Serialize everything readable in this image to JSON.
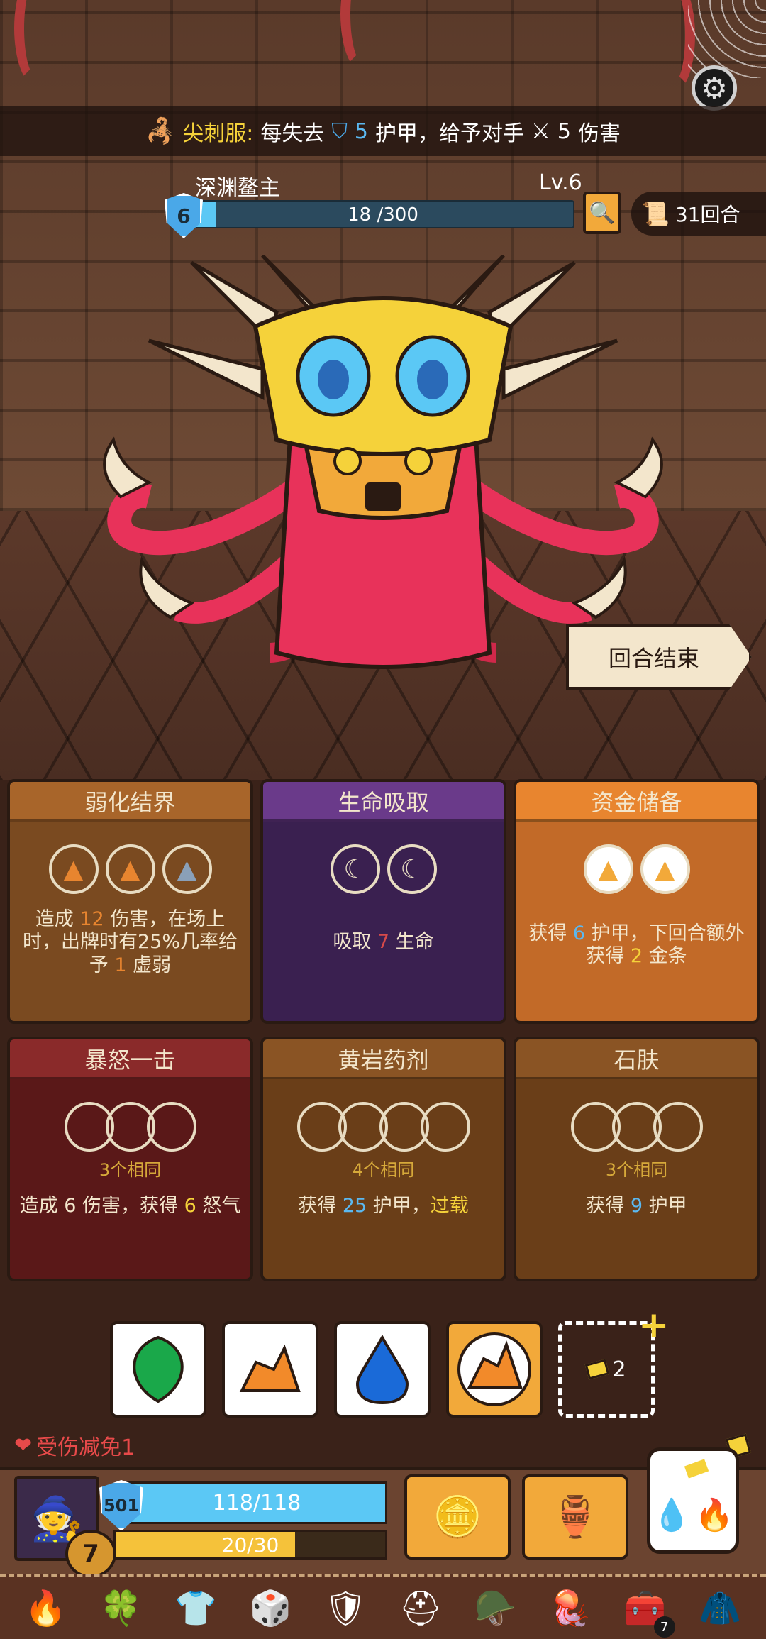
{
  "boss_trait": {
    "name": "尖刺服:",
    "text_before": "每失去",
    "armor_amount": "5",
    "text_middle": "护甲，给予对手",
    "damage_amount": "5",
    "text_after": "伤害"
  },
  "enemy": {
    "name": "深渊鳌主",
    "level": "Lv.6",
    "shield": "6",
    "hp_text": "18 /300",
    "hp_fraction": 0.06
  },
  "turns": "31回合",
  "end_turn_label": "回合结束",
  "cards": [
    {
      "title": "弱化结界",
      "desc_parts": [
        "造成 ",
        "12",
        " 伤害，在场上时，出牌时有25%几率给予 ",
        "1",
        " 虚弱"
      ]
    },
    {
      "title": "生命吸取",
      "desc_parts": [
        "吸取 ",
        "7",
        " 生命"
      ]
    },
    {
      "title": "资金储备",
      "desc_parts": [
        "获得 ",
        "6",
        " 护甲，下回合额外获得 ",
        "2",
        " 金条"
      ]
    },
    {
      "title": "暴怒一击",
      "requirement": "3个相同",
      "desc_parts": [
        "造成 ",
        "6",
        " 伤害，获得 ",
        "6",
        " 怒气"
      ]
    },
    {
      "title": "黄岩药剂",
      "requirement": "4个相同",
      "desc_parts": [
        "获得 ",
        "25",
        " 护甲，",
        "过载"
      ]
    },
    {
      "title": "石肤",
      "requirement": "3个相同",
      "desc_parts": [
        "获得 ",
        "9",
        " 护甲"
      ]
    }
  ],
  "dice_tray": {
    "gold_count": "2"
  },
  "damage_reduce": "受伤减免1",
  "player": {
    "shield": "501",
    "hp_text": "118/118",
    "energy_text": "20/30",
    "energy_fraction": 0.667,
    "gold": "7"
  },
  "equipment_badge": "7",
  "colors": {
    "accent_gold": "#f5d23a",
    "armor_blue": "#5bb8f0",
    "hp_blue": "#5bc8f5",
    "energy_yellow": "#f5c23a",
    "selected_die": "#f2a93a"
  },
  "icons": {
    "settings": "gear-icon",
    "inspect": "magnifier-icon",
    "turns": "scroll-icon",
    "damage_reduce": "heart-icon"
  }
}
